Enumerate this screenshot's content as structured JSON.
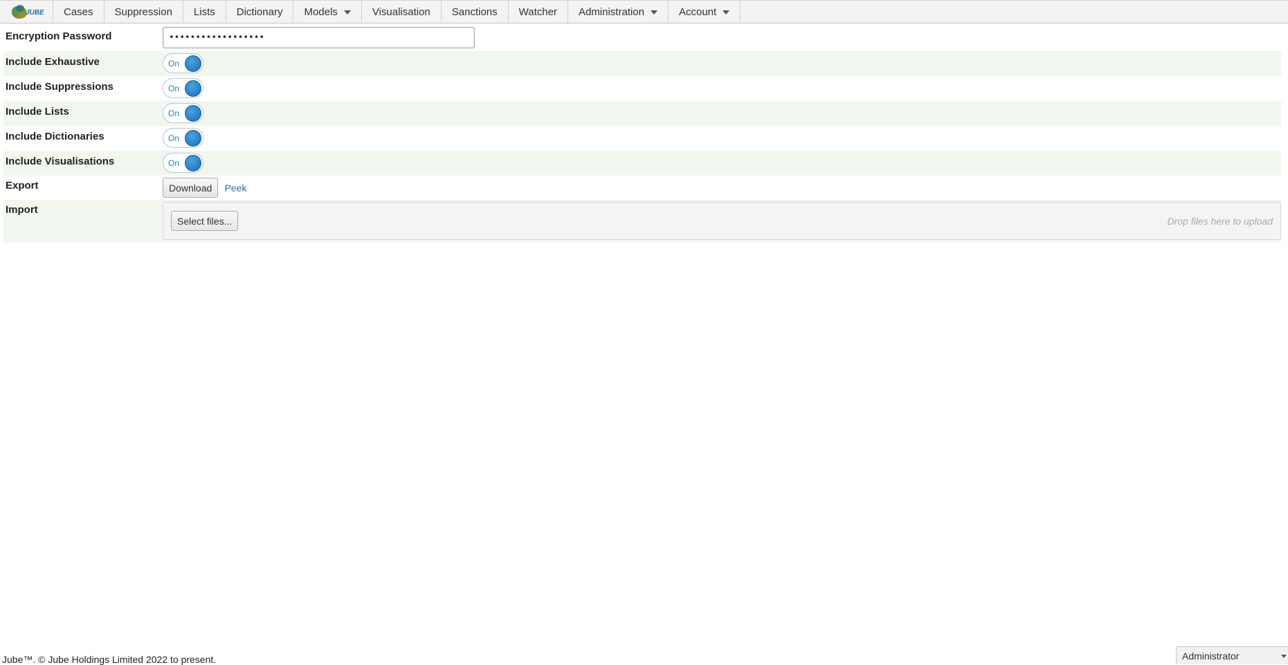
{
  "menu": {
    "logo_text": "JUBE",
    "items": [
      {
        "label": "Cases",
        "has_caret": false
      },
      {
        "label": "Suppression",
        "has_caret": false
      },
      {
        "label": "Lists",
        "has_caret": false
      },
      {
        "label": "Dictionary",
        "has_caret": false
      },
      {
        "label": "Models",
        "has_caret": true
      },
      {
        "label": "Visualisation",
        "has_caret": false
      },
      {
        "label": "Sanctions",
        "has_caret": false
      },
      {
        "label": "Watcher",
        "has_caret": false
      },
      {
        "label": "Administration",
        "has_caret": true
      },
      {
        "label": "Account",
        "has_caret": true
      }
    ]
  },
  "form": {
    "password": {
      "label": "Encryption Password",
      "value": "••••••••••••••••••"
    },
    "toggles": [
      {
        "label": "Include Exhaustive",
        "state": "On"
      },
      {
        "label": "Include Suppressions",
        "state": "On"
      },
      {
        "label": "Include Lists",
        "state": "On"
      },
      {
        "label": "Include Dictionaries",
        "state": "On"
      },
      {
        "label": "Include Visualisations",
        "state": "On"
      }
    ],
    "export": {
      "label": "Export",
      "download_label": "Download",
      "peek_label": "Peek"
    },
    "import": {
      "label": "Import",
      "select_label": "Select files...",
      "drop_hint": "Drop files here to upload"
    }
  },
  "footer": {
    "copyright": "Jube™. © Jube Holdings Limited 2022 to present."
  },
  "user_menu": {
    "selected": "Administrator"
  },
  "colors": {
    "accent": "#2b82c9",
    "row_alt": "#f1f7ee",
    "menu_bg": "#f3f3f3"
  }
}
